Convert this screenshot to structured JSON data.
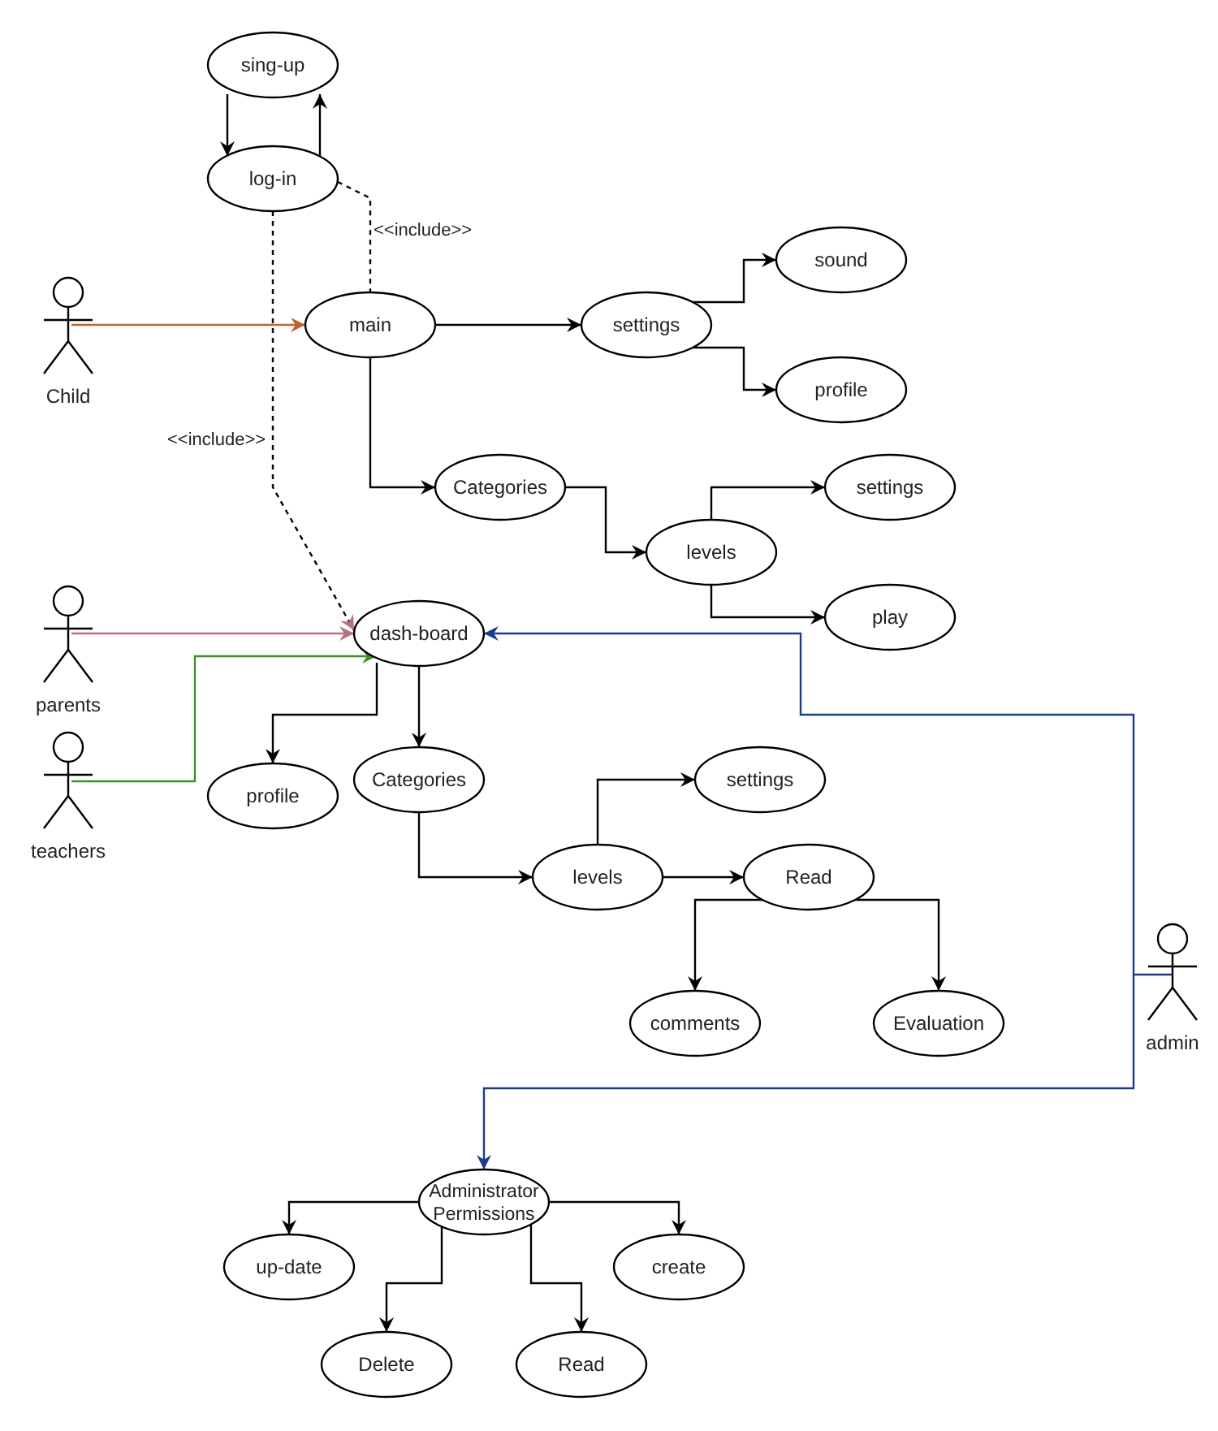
{
  "use_cases": [
    {
      "label": "sing-up"
    },
    {
      "label": "log-in"
    },
    {
      "label": "main"
    },
    {
      "label": "settings"
    },
    {
      "label": "sound"
    },
    {
      "label": "profile"
    },
    {
      "label": "Categories"
    },
    {
      "label": "levels"
    },
    {
      "label": "settings"
    },
    {
      "label": "play"
    },
    {
      "label": "dash-board"
    },
    {
      "label": "profile"
    },
    {
      "label": "Categories"
    },
    {
      "label": "settings"
    },
    {
      "label": "levels"
    },
    {
      "label": "Read"
    },
    {
      "label": "comments"
    },
    {
      "label": "Evaluation"
    },
    {
      "label": "Administrator Permissions"
    },
    {
      "label": "up-date"
    },
    {
      "label": "create"
    },
    {
      "label": "Delete"
    },
    {
      "label": "Read"
    }
  ],
  "actors": [
    {
      "name": "Child",
      "color": "#c0622c"
    },
    {
      "name": "parents",
      "color": "#b5737a"
    },
    {
      "name": "teachers",
      "color": "#3f8f22"
    },
    {
      "name": "admin",
      "color": "#1a3c8c"
    }
  ],
  "include_labels": [
    "<<include>>",
    "<<include>>"
  ]
}
